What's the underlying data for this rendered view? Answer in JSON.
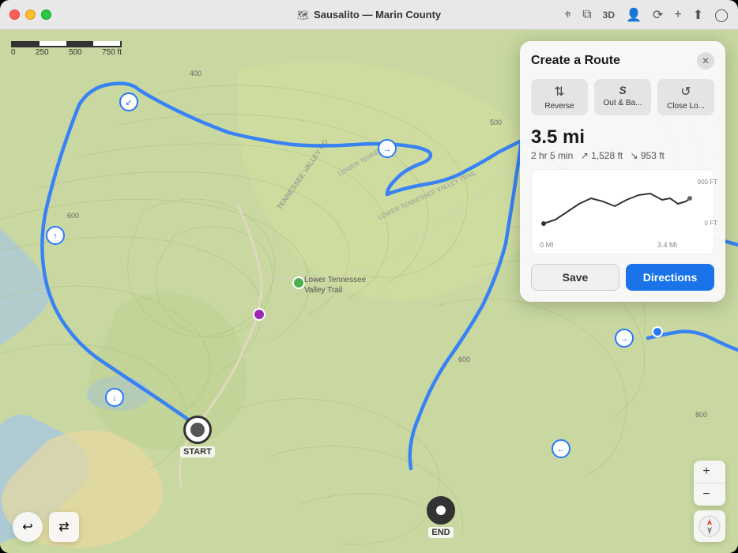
{
  "window": {
    "title": "Sausalito — Marin County",
    "title_icon": "📍"
  },
  "toolbar": {
    "location_icon": "⌖",
    "layers_icon": "⊞",
    "threed_label": "3D",
    "people_icon": "👤",
    "refresh_icon": "⟳",
    "add_icon": "+",
    "share_icon": "⬆",
    "profile_icon": "◯"
  },
  "scale": {
    "labels": [
      "0",
      "250",
      "500",
      "750 ft"
    ]
  },
  "panel": {
    "title": "Create a Route",
    "close_icon": "✕",
    "options": [
      {
        "id": "reverse",
        "icon": "↑↓",
        "label": "Reverse"
      },
      {
        "id": "out-back",
        "icon": "S",
        "label": "Out & Ba..."
      },
      {
        "id": "close-loop",
        "icon": "↺",
        "label": "Close Lo..."
      }
    ],
    "distance": "3.5 mi",
    "meta_time": "2 hr 5 min",
    "meta_ascent": "↗ 1,528 ft",
    "meta_descent": "↘ 953 ft",
    "chart": {
      "y_labels": [
        "900 FT",
        "0 FT"
      ],
      "x_labels": [
        "0 MI",
        "3.4 MI"
      ]
    },
    "save_label": "Save",
    "directions_label": "Directions"
  },
  "map": {
    "start_label": "START",
    "end_label": "END",
    "place_name": "Lower Tennessee\nValley Trail"
  },
  "controls": {
    "zoom_in": "+",
    "zoom_out": "−",
    "compass": "N",
    "back_icon": "↩",
    "layers_icon": "⇄"
  }
}
